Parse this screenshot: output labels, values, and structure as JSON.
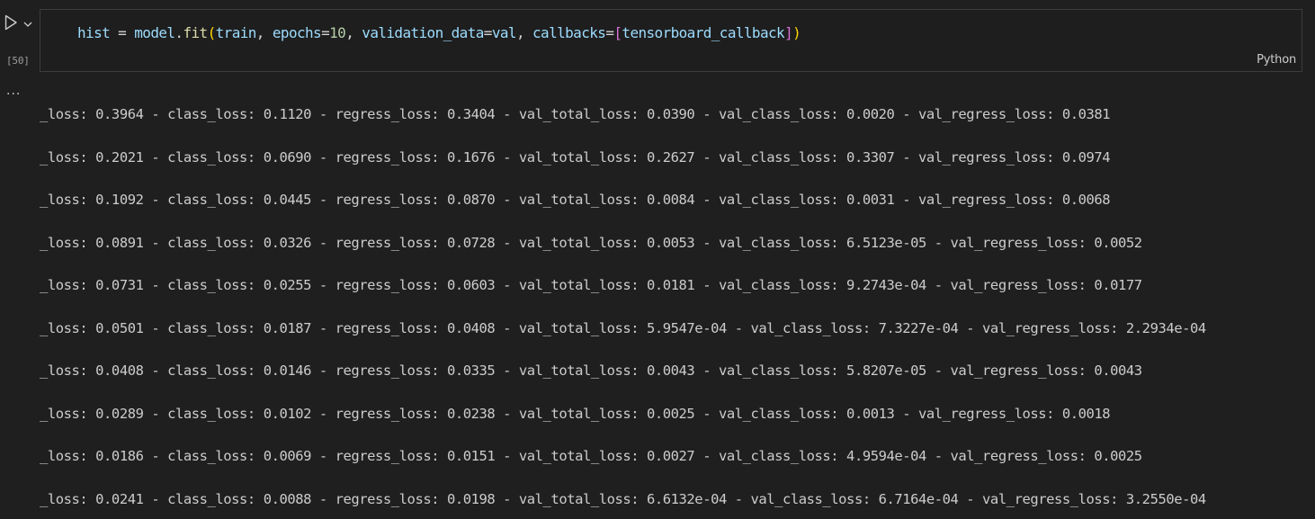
{
  "cell": {
    "execution_count": "[50]",
    "language": "Python",
    "code": {
      "var_hist": "hist",
      "eq1": " = ",
      "var_model": "model",
      "dot": ".",
      "fn_fit": "fit",
      "lparen": "(",
      "arg_train": "train",
      "comma1": ", ",
      "kw_epochs": "epochs",
      "eq2": "=",
      "num_epochs": "10",
      "comma2": ", ",
      "kw_validation": "validation_data",
      "eq3": "=",
      "arg_val": "val",
      "comma3": ", ",
      "kw_callbacks": "callbacks",
      "eq4": "=",
      "lbracket": "[",
      "arg_callback": "tensorboard_callback",
      "rbracket": "]",
      "rparen": ")"
    }
  },
  "output": {
    "menu_label": "...",
    "lines": [
      "_loss: 0.3964 - class_loss: 0.1120 - regress_loss: 0.3404 - val_total_loss: 0.0390 - val_class_loss: 0.0020 - val_regress_loss: 0.0381",
      "_loss: 0.2021 - class_loss: 0.0690 - regress_loss: 0.1676 - val_total_loss: 0.2627 - val_class_loss: 0.3307 - val_regress_loss: 0.0974",
      "_loss: 0.1092 - class_loss: 0.0445 - regress_loss: 0.0870 - val_total_loss: 0.0084 - val_class_loss: 0.0031 - val_regress_loss: 0.0068",
      "_loss: 0.0891 - class_loss: 0.0326 - regress_loss: 0.0728 - val_total_loss: 0.0053 - val_class_loss: 6.5123e-05 - val_regress_loss: 0.0052",
      "_loss: 0.0731 - class_loss: 0.0255 - regress_loss: 0.0603 - val_total_loss: 0.0181 - val_class_loss: 9.2743e-04 - val_regress_loss: 0.0177",
      "_loss: 0.0501 - class_loss: 0.0187 - regress_loss: 0.0408 - val_total_loss: 5.9547e-04 - val_class_loss: 7.3227e-04 - val_regress_loss: 2.2934e-04",
      "_loss: 0.0408 - class_loss: 0.0146 - regress_loss: 0.0335 - val_total_loss: 0.0043 - val_class_loss: 5.8207e-05 - val_regress_loss: 0.0043",
      "_loss: 0.0289 - class_loss: 0.0102 - regress_loss: 0.0238 - val_total_loss: 0.0025 - val_class_loss: 0.0013 - val_regress_loss: 0.0018",
      "_loss: 0.0186 - class_loss: 0.0069 - regress_loss: 0.0151 - val_total_loss: 0.0027 - val_class_loss: 4.9594e-04 - val_regress_loss: 0.0025",
      "_loss: 0.0241 - class_loss: 0.0088 - regress_loss: 0.0198 - val_total_loss: 6.6132e-04 - val_class_loss: 6.7164e-04 - val_regress_loss: 3.2550e-04"
    ]
  },
  "icons": {
    "run": "run-cell-icon",
    "chevron": "chevron-down-icon",
    "more": "ellipsis-icon"
  },
  "colors": {
    "background": "#1f1f1f",
    "editor_border": "#3c3c3c",
    "variable": "#9cdcfe",
    "function": "#dcdcaa",
    "number": "#b5cea8",
    "bracket_level1": "#ffd700",
    "bracket_level2": "#da70d6",
    "output_text": "#cccccc"
  }
}
